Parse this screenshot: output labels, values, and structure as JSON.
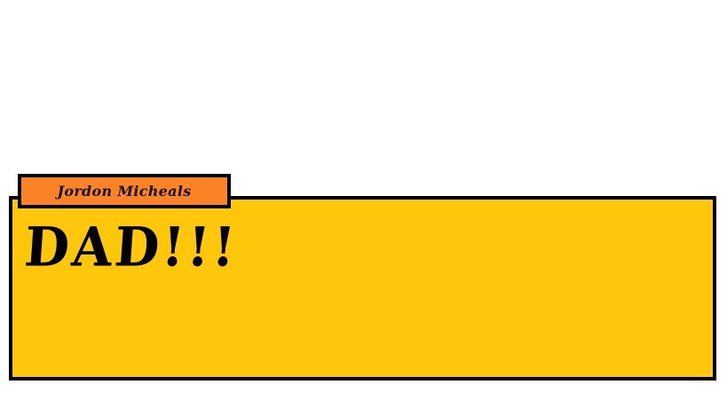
{
  "dialog": {
    "speaker": "Jordon Micheals",
    "text": "DAD!!!"
  },
  "colors": {
    "dialog_background": "#fec70c",
    "name_tag_background": "#fe8327",
    "border": "#000000",
    "text": "#000000"
  }
}
